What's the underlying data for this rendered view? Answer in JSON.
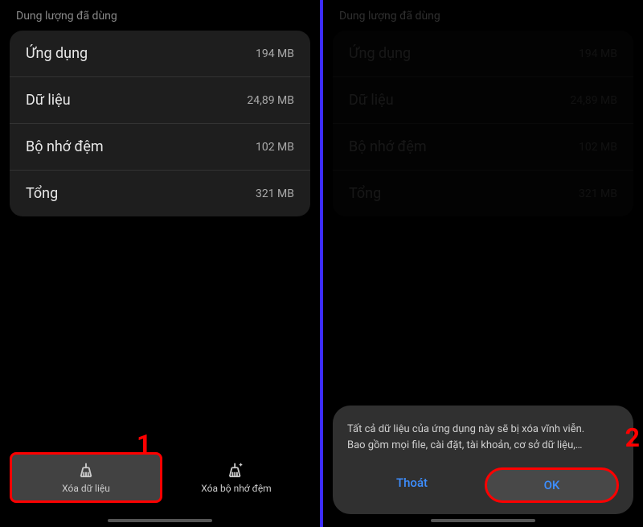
{
  "section_title": "Dung lượng đã dùng",
  "storage": [
    {
      "label": "Ứng dụng",
      "value": "194 MB"
    },
    {
      "label": "Dữ liệu",
      "value": "24,89 MB"
    },
    {
      "label": "Bộ nhớ đệm",
      "value": "102 MB"
    },
    {
      "label": "Tổng",
      "value": "321 MB"
    }
  ],
  "actions": {
    "clear_data": "Xóa dữ liệu",
    "clear_cache": "Xóa bộ nhớ đệm"
  },
  "dialog": {
    "line1": "Tất cả dữ liệu của ứng dụng này sẽ bị xóa vĩnh viễn.",
    "line2": "Bao gồm mọi file, cài đặt, tài khoản, cơ sở dữ liệu,…",
    "exit": "Thoát",
    "ok": "OK"
  },
  "steps": {
    "one": "1",
    "two": "2"
  }
}
